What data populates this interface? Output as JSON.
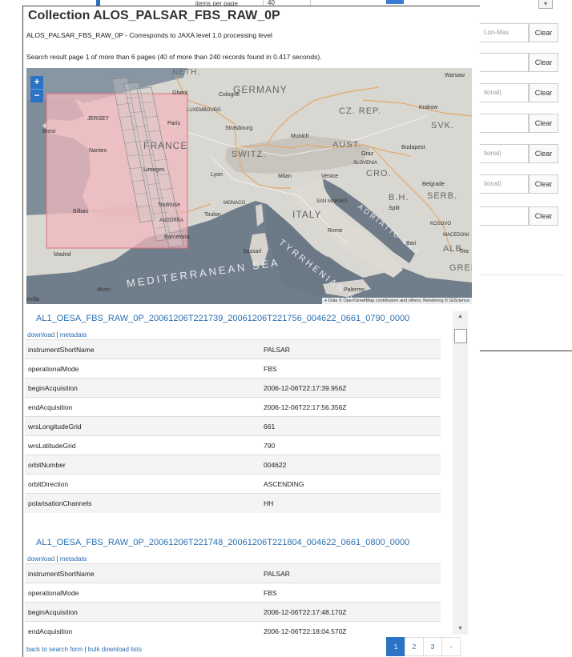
{
  "background_form": {
    "items_per_page_label": "items per page",
    "items_per_page_value": "40",
    "dropdown_icon": "chevron-down-icon",
    "rows": [
      {
        "placeholder": "Lon-Max",
        "clear": "Clear"
      },
      {
        "placeholder": "",
        "clear": "Clear"
      },
      {
        "placeholder": "tional)",
        "clear": "Clear"
      },
      {
        "placeholder": "",
        "clear": "Clear"
      },
      {
        "placeholder": "tional)",
        "clear": "Clear"
      },
      {
        "placeholder": "tional)",
        "clear": "Clear"
      },
      {
        "placeholder": "",
        "clear": "Clear"
      }
    ]
  },
  "modal": {
    "title": "Collection ALOS_PALSAR_FBS_RAW_0P",
    "subtitle": "ALOS_PALSAR_FBS_RAW_0P - Corresponds to JAXA level 1.0 processing level",
    "result_info": "Search result page 1 of more than 6 pages (40 of more than 240 records found in 0.417 seconds)."
  },
  "map": {
    "zoom_in": "+",
    "zoom_out": "−",
    "labels": {
      "germany": "GERMANY",
      "cz_rep": "CZ. REP.",
      "svk": "SVK.",
      "france": "FRANCE",
      "switz": "SWITZ.",
      "aust": "AUST.",
      "slovenia": "SLOVENIA",
      "cro": "CRO.",
      "bh": "B.H.",
      "serb": "SERB.",
      "italy": "ITALY",
      "alb": "ALB.",
      "greece": "GREEC",
      "tyrrhenian_sea": "TYRRHENIAN SEA",
      "adriatic_sea": "ADRIATIC SEA",
      "mediterranean_sea": "MEDITERRANEAN SEA",
      "neth": "NETH.",
      "warsaw": "Warsaw",
      "krakow": "Krakow",
      "ghent": "Ghent",
      "cologne": "Cologne",
      "luxembourg": "LUXEMBOURG",
      "jersey": "JERSEY",
      "paris": "Paris",
      "strasbourg": "Strasbourg",
      "munich": "Munich",
      "graz": "Graz",
      "budapest": "Budapest",
      "brest": "Brest",
      "nantes": "Nantes",
      "limoges": "Limoges",
      "lyon": "Lyon",
      "milan": "Milan",
      "venice": "Venice",
      "belgrade": "Belgrade",
      "bilbao": "Bilbao",
      "toulouse": "Toulouse",
      "andorra": "ANDORRA",
      "monaco": "MONACO",
      "toulon": "Toulon",
      "san_marino": "SAN MARINO",
      "split": "Split",
      "kosovo": "KOSOVO",
      "macedonia": "MACEDONI",
      "barcelona": "Barcelona",
      "rome": "Rome",
      "bari": "Bari",
      "madrid": "Madrid",
      "sassari": "Sassari",
      "murcia": "Murci",
      "palermo": "Palermo",
      "sevilla": "evilla",
      "tirana": "Tira"
    },
    "attribution": "Data © OpenStreetMap contributors and others, Rendering © GIScience"
  },
  "records": [
    {
      "id": "AL1_OESA_FBS_RAW_0P_20061206T221739_20061206T221756_004622_0661_0790_0000",
      "download": "download",
      "metadata": "metadata",
      "separator": "|",
      "rows": [
        {
          "key": "instrumentShortName",
          "value": "PALSAR"
        },
        {
          "key": "operationalMode",
          "value": "FBS"
        },
        {
          "key": "beginAcquisition",
          "value": "2006-12-06T22:17:39.956Z"
        },
        {
          "key": "endAcquisition",
          "value": "2006-12-06T22:17:56.356Z"
        },
        {
          "key": "wrsLongitudeGrid",
          "value": "661"
        },
        {
          "key": "wrsLatitudeGrid",
          "value": "790"
        },
        {
          "key": "orbitNumber",
          "value": "004622"
        },
        {
          "key": "orbitDirection",
          "value": "ASCENDING"
        },
        {
          "key": "polarisationChannels",
          "value": "HH"
        }
      ]
    },
    {
      "id": "AL1_OESA_FBS_RAW_0P_20061206T221748_20061206T221804_004622_0661_0800_0000",
      "download": "download",
      "metadata": "metadata",
      "separator": "|",
      "rows": [
        {
          "key": "instrumentShortName",
          "value": "PALSAR"
        },
        {
          "key": "operationalMode",
          "value": "FBS"
        },
        {
          "key": "beginAcquisition",
          "value": "2006-12-06T22:17:48.170Z"
        },
        {
          "key": "endAcquisition",
          "value": "2006-12-06T22:18:04.570Z"
        }
      ]
    }
  ],
  "footer": {
    "back_link": "back to search form",
    "separator": "|",
    "bulk_link": "bulk download lists",
    "pages": [
      "1",
      "2",
      "3"
    ],
    "active_page": "1",
    "next": "›"
  },
  "colors": {
    "link": "#2a6fb0",
    "accent": "#2a73c5",
    "footprint_fill": "#f2b8bd",
    "footprint_stroke": "#d9707a"
  }
}
